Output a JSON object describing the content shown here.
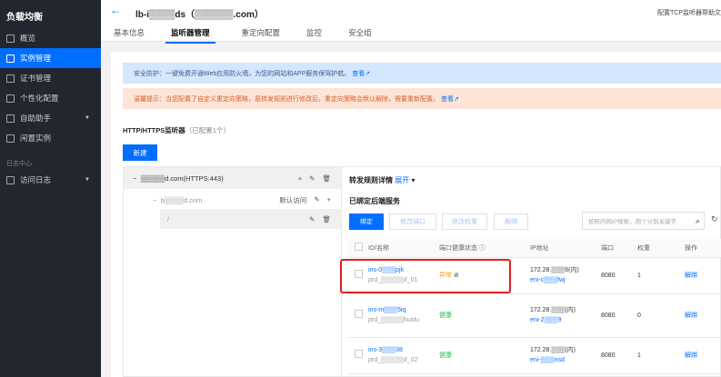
{
  "sidebar": {
    "title": "负载均衡",
    "items": [
      {
        "label": "概览"
      },
      {
        "label": "实例管理"
      },
      {
        "label": "证书管理"
      },
      {
        "label": "个性化配置"
      },
      {
        "label": "自助助手"
      },
      {
        "label": "闲置实例"
      }
    ],
    "group": "日志中心",
    "group_items": [
      {
        "label": "访问日志"
      }
    ]
  },
  "header": {
    "title": "lb-i▒▒▒▒ds（▒▒▒▒▒▒.com）",
    "right_link": "配置TCP监听器帮助文",
    "tabs": [
      "基本信息",
      "监听器管理",
      "重定向配置",
      "监控",
      "安全组"
    ]
  },
  "notices": {
    "security": "安全防护：一键免费开通Web应用防火墙，为您的网站和APP服务保驾护航。",
    "security_link": "查看",
    "tip": "温馨提示：当您配置了自定义重定向策略，原转发规则进行修改后，重定向策略会默认解除，需要重新配置。",
    "tip_link": "查看"
  },
  "listeners": {
    "title": "HTTP/HTTPS监听器",
    "count": "（已配置1个）",
    "new_button": "新建",
    "tree": {
      "listener": "▒▒▒▒▒d.com(HTTPS:443)",
      "domain": "b▒▒▒▒d.com",
      "default_label": "默认访问",
      "path": "/"
    }
  },
  "detail": {
    "title": "转发规则详情",
    "expand": "展开",
    "bound_title": "已绑定后端服务",
    "buttons": [
      "绑定",
      "修改端口",
      "修改权重",
      "解绑"
    ],
    "search_placeholder": "按照内网IP搜索，用\"|\"分割关键字",
    "columns": [
      "ID/名称",
      "端口健康状态",
      "IP地址",
      "端口",
      "权重",
      "操作"
    ],
    "rows": [
      {
        "id": "ins-0▒▒▒pjk",
        "name": "prd_▒▒▒▒▒d_01",
        "health": "异常",
        "ip": "172.28.▒▒▒6(内)",
        "eni": "eni-c▒▒▒fwj",
        "port": "8080",
        "weight": "1",
        "action": "解绑"
      },
      {
        "id": "ins-m▒▒▒5iq",
        "name": "prd_▒▒▒▒▒huidu",
        "health": "健康",
        "ip": "172.28.▒▒▒(内)",
        "eni": "eni-2▒▒▒9",
        "port": "8080",
        "weight": "0",
        "action": "解绑"
      },
      {
        "id": "ins-3▒▒▒38",
        "name": "prd_▒▒▒▒▒d_02",
        "health": "健康",
        "ip": "172.28.▒▒▒(内)",
        "eni": "eni-▒▒▒nsd",
        "port": "8080",
        "weight": "1",
        "action": "解绑"
      }
    ]
  }
}
